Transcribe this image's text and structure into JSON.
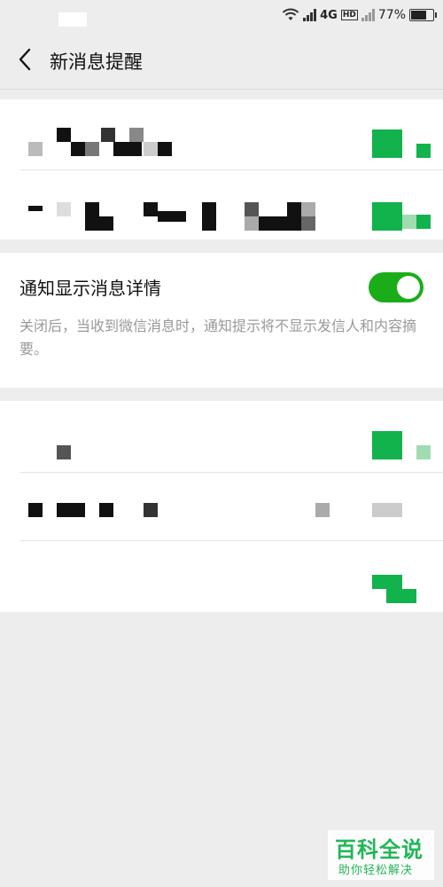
{
  "status_bar": {
    "network": "4G",
    "hd": "HD",
    "battery_text": "77%",
    "battery_level": 0.77
  },
  "header": {
    "back_icon": "chevron-left-icon",
    "title": "新消息提醒"
  },
  "notification_details": {
    "label": "通知显示消息详情",
    "enabled": true,
    "description": "关闭后，当收到微信消息时，通知提示将不显示发信人和内容摘要。"
  },
  "watermark": {
    "title": "百科全说",
    "subtitle": "助你轻松解决"
  },
  "colors": {
    "accent_green": "#1aad19",
    "watermark_green": "#12b24c",
    "background": "#ededed"
  }
}
